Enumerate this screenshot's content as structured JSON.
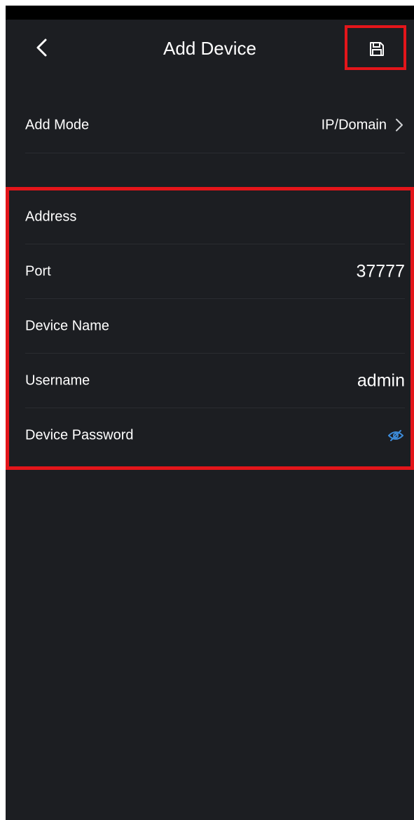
{
  "header": {
    "title": "Add Device",
    "back_icon": "chevron-left-icon",
    "save_icon": "floppy-disk-icon"
  },
  "add_mode": {
    "label": "Add Mode",
    "value": "IP/Domain",
    "chevron_icon": "chevron-right-icon"
  },
  "fields": [
    {
      "label": "Address",
      "value": ""
    },
    {
      "label": "Port",
      "value": "37777"
    },
    {
      "label": "Device Name",
      "value": ""
    },
    {
      "label": "Username",
      "value": "admin"
    },
    {
      "label": "Device Password",
      "value": "",
      "icon": "eye-hidden-icon"
    }
  ],
  "colors": {
    "background": "#1c1e22",
    "text": "#ffffff",
    "highlight": "#e3151a",
    "accent": "#3d8bd9"
  }
}
